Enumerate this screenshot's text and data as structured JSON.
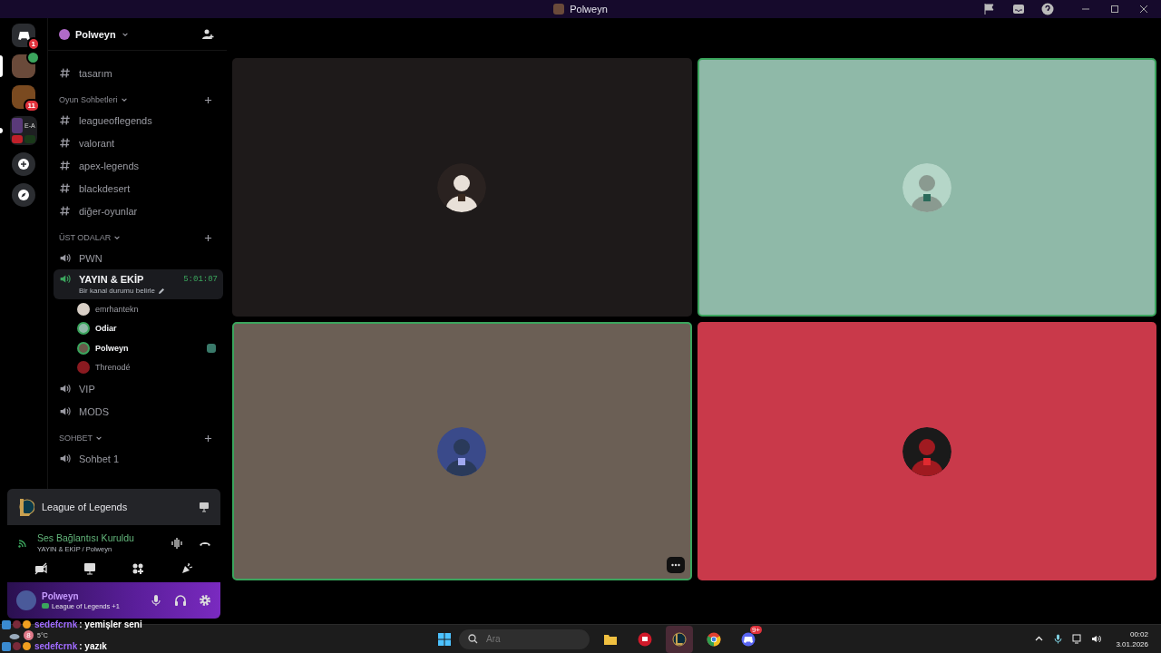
{
  "window": {
    "title": "Polweyn"
  },
  "servers": [
    {
      "kind": "home",
      "badge": "1",
      "selected": false,
      "in_voice": false,
      "unread": false
    },
    {
      "kind": "avatar",
      "color": "#6a4a3a",
      "selected": true,
      "in_voice": true,
      "unread": false
    },
    {
      "kind": "avatar",
      "color": "#7a4a20",
      "badge": "11",
      "selected": false,
      "in_voice": false,
      "unread": false
    },
    {
      "kind": "folder",
      "label": "E-A",
      "selected": false,
      "in_voice": false,
      "unread": true
    },
    {
      "kind": "add",
      "selected": false,
      "in_voice": false,
      "unread": false
    },
    {
      "kind": "discover",
      "selected": false,
      "in_voice": false,
      "unread": false
    }
  ],
  "guild": {
    "name": "Polweyn"
  },
  "channel_list": [
    {
      "kind": "text",
      "name": "tasarım",
      "selected": false
    },
    {
      "kind": "category",
      "name": "Oyun Sohbetleri"
    },
    {
      "kind": "text",
      "name": "leagueoflegends",
      "selected": false
    },
    {
      "kind": "text",
      "name": "valorant",
      "selected": false
    },
    {
      "kind": "text",
      "name": "apex-legends",
      "selected": false
    },
    {
      "kind": "text",
      "name": "blackdesert",
      "selected": false
    },
    {
      "kind": "text",
      "name": "diğer-oyunlar",
      "selected": false
    },
    {
      "kind": "category",
      "name": "ÜST ODALAR"
    },
    {
      "kind": "voice",
      "name": "PWN",
      "selected": false
    },
    {
      "kind": "voice",
      "name": "YAYIN & EKİP",
      "selected": true,
      "timer": "5:01:07",
      "status": "Bir kanal durumu belirle",
      "members": [
        {
          "name": "emrhantekn",
          "speaking": false,
          "color": "#d8cfc6"
        },
        {
          "name": "Odiar",
          "speaking": true,
          "color": "#8fb9a8"
        },
        {
          "name": "Polweyn",
          "speaking": true,
          "color": "#6a5a4a",
          "activity": true
        },
        {
          "name": "Threnodé",
          "speaking": false,
          "color": "#8a1a20"
        }
      ]
    },
    {
      "kind": "voice",
      "name": "VIP",
      "selected": false
    },
    {
      "kind": "voice",
      "name": "MODS",
      "selected": false
    },
    {
      "kind": "category",
      "name": "SOHBET"
    },
    {
      "kind": "voice",
      "name": "Sohbet 1",
      "selected": false
    }
  ],
  "activity": {
    "game": "League of Legends"
  },
  "voice_status": {
    "title": "Ses Bağlantısı Kuruldu",
    "channel": "YAYIN & EKİP / Polweyn"
  },
  "user": {
    "name": "Polweyn",
    "activity": "League of Legends +1"
  },
  "tiles": [
    {
      "color": "#1e1a1a",
      "speaking": false,
      "menu": false
    },
    {
      "color": "#8fb9a8",
      "speaking": true,
      "menu": false
    },
    {
      "color": "#6b5f55",
      "speaking": true,
      "menu": true
    },
    {
      "color": "#c9394a",
      "speaking": false,
      "menu": false
    }
  ],
  "chat_overlay": {
    "messages": [
      {
        "user": "sedefcrnk",
        "text": ": yemişler seni"
      },
      {
        "user": "sedefcrnk",
        "text": ": yazık"
      }
    ],
    "weather": "5°C",
    "weather_badge": "8"
  },
  "taskbar": {
    "search_placeholder": "Ara",
    "apps": [
      {
        "kind": "folder",
        "selected": false
      },
      {
        "kind": "red",
        "selected": false
      },
      {
        "kind": "league",
        "selected": true
      },
      {
        "kind": "chrome",
        "selected": false
      },
      {
        "kind": "discord",
        "selected": false,
        "badge": "9+"
      }
    ],
    "time": "00:02",
    "date": "3.01.2026"
  }
}
